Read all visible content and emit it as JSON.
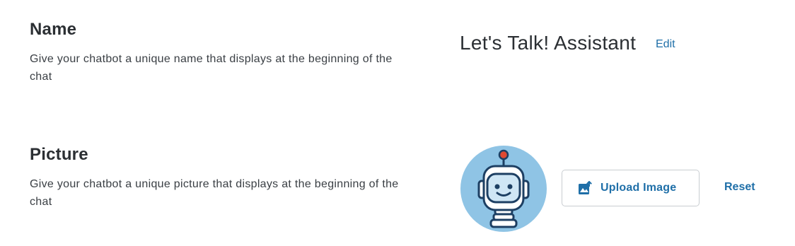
{
  "name_section": {
    "heading": "Name",
    "description": "Give your chatbot a unique name that displays at the beginning of the chat",
    "value": "Let's Talk! Assistant",
    "edit_label": "Edit"
  },
  "picture_section": {
    "heading": "Picture",
    "description": "Give your chatbot a unique picture that displays at the beginning of the chat",
    "avatar_icon": "robot-avatar-icon",
    "upload_label": "Upload Image",
    "upload_icon": "image-upload-icon",
    "reset_label": "Reset"
  },
  "colors": {
    "accent": "#1f6fa8",
    "avatar_bg": "#8fc4e5",
    "heading": "#2b2f33"
  }
}
